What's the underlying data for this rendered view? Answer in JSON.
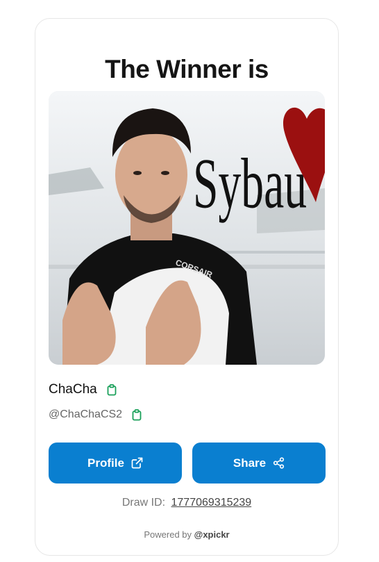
{
  "card": {
    "title": "The Winner is",
    "winner_name": "ChaCha",
    "winner_handle": "@ChaChaCS2",
    "profile_label": "Profile",
    "share_label": "Share",
    "draw_id_label": "Draw ID:",
    "draw_id_value": "1777069315239",
    "powered_prefix": "Powered by",
    "powered_brand": "@xpickr"
  },
  "photo": {
    "overlay_text": "Sybau",
    "jersey_text": "CORSAIR"
  },
  "colors": {
    "accent": "#0a7fd0",
    "clipboard": "#1aa05a"
  },
  "icons": [
    "clipboard-icon",
    "external-link-icon",
    "share-icon"
  ]
}
